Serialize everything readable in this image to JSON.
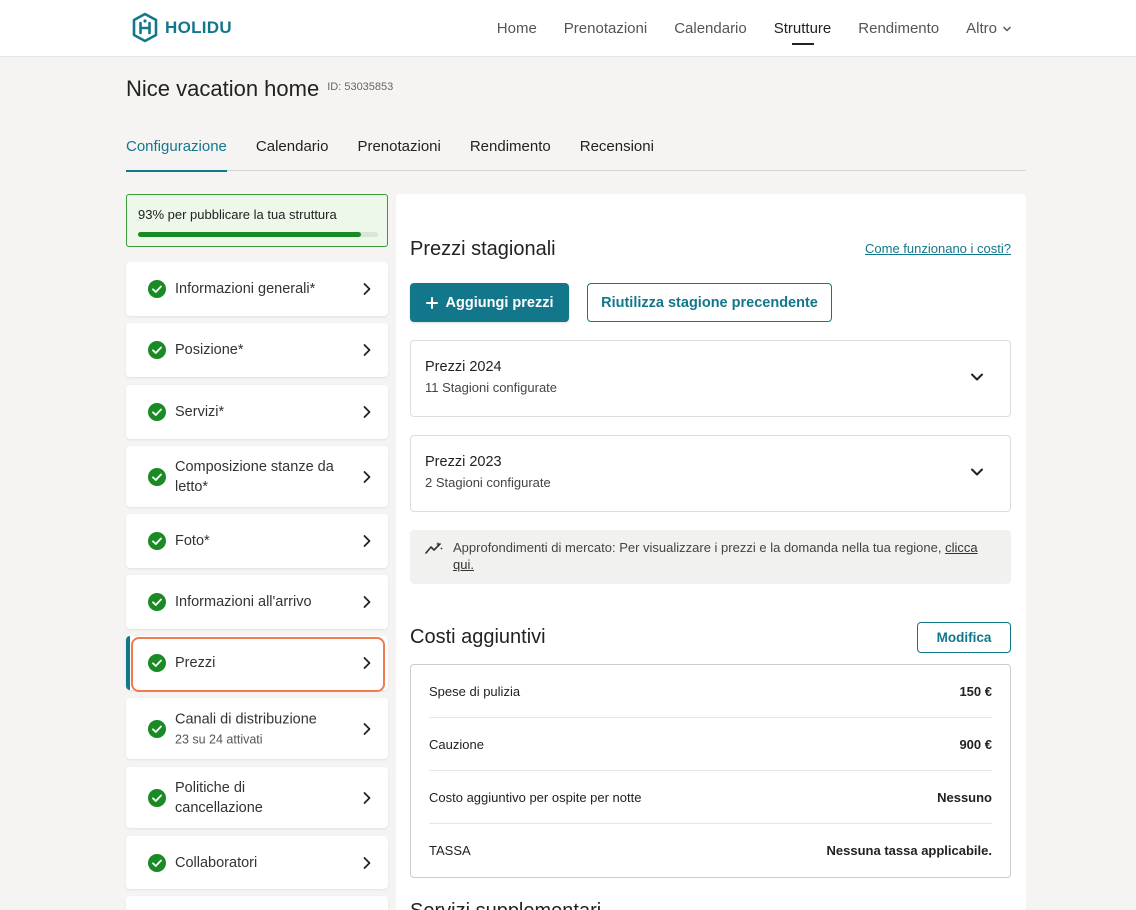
{
  "header": {
    "logo_text": "HOLIDU",
    "nav": [
      {
        "label": "Home"
      },
      {
        "label": "Prenotazioni"
      },
      {
        "label": "Calendario"
      },
      {
        "label": "Strutture"
      },
      {
        "label": "Rendimento"
      },
      {
        "label": "Altro"
      }
    ],
    "active_nav": "Strutture"
  },
  "property": {
    "title": "Nice vacation home",
    "id_label": "ID: 53035853"
  },
  "tabs": [
    {
      "label": "Configurazione"
    },
    {
      "label": "Calendario"
    },
    {
      "label": "Prenotazioni"
    },
    {
      "label": "Rendimento"
    },
    {
      "label": "Recensioni"
    }
  ],
  "active_tab": "Configurazione",
  "sidebar": {
    "progress": {
      "text": "93% per pubblicare la tua struttura",
      "percent": 93
    },
    "items": [
      {
        "label": "Informazioni generali*"
      },
      {
        "label": "Posizione*"
      },
      {
        "label": "Servizi*"
      },
      {
        "label": "Composizione stanze da letto*"
      },
      {
        "label": "Foto*"
      },
      {
        "label": "Informazioni all'arrivo"
      },
      {
        "label": "Prezzi"
      },
      {
        "label": "Canali di distribuzione",
        "sub": "23 su 24 attivati"
      },
      {
        "label": "Politiche di cancellazione"
      },
      {
        "label": "Collaboratori"
      }
    ],
    "active_item": "Prezzi"
  },
  "main": {
    "seasonal": {
      "title": "Prezzi stagionali",
      "help_link": "Come funzionano i costi?",
      "add_button": "Aggiungi prezzi",
      "reuse_button": "Riutilizza stagione precendente",
      "seasons": [
        {
          "title": "Prezzi 2024",
          "sub": "11 Stagioni configurate"
        },
        {
          "title": "Prezzi 2023",
          "sub": "2 Stagioni configurate"
        }
      ]
    },
    "insight": {
      "text": "Approfondimenti di mercato: Per visualizzare i prezzi e la domanda nella tua regione, ",
      "link": "clicca qui."
    },
    "extra_costs": {
      "title": "Costi aggiuntivi",
      "edit_button": "Modifica",
      "rows": [
        {
          "label": "Spese di pulizia",
          "value": "150 €"
        },
        {
          "label": "Cauzione",
          "value": "900 €"
        },
        {
          "label": "Costo aggiuntivo per ospite per notte",
          "value": "Nessuno"
        },
        {
          "label": "TASSA",
          "value": "Nessuna tassa applicabile."
        }
      ]
    },
    "next_section_title": "Servizi supplementari"
  },
  "colors": {
    "brand": "#13778b",
    "success": "#1a8a24",
    "highlight": "#f07b4f"
  }
}
